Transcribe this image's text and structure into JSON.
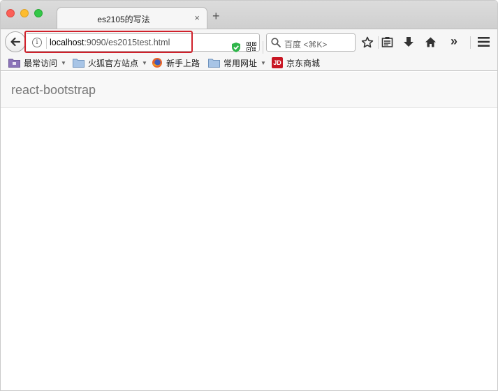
{
  "tab": {
    "title": "es2105的写法",
    "close_glyph": "×",
    "new_tab_glyph": "+"
  },
  "url": {
    "host": "localhost",
    "path": ":9090/es2015test.html",
    "info_glyph": "i"
  },
  "search": {
    "placeholder": "百度 <⌘K>"
  },
  "toolbar_icons": [
    "back-icon",
    "info-icon",
    "shield-icon",
    "qr-code-icon",
    "reload-icon",
    "search-icon",
    "star-icon",
    "reading-list-icon",
    "download-icon",
    "home-icon",
    "overflow-icon",
    "menu-icon"
  ],
  "toolbar": {
    "overflow_glyph": "»"
  },
  "bookmarks": [
    {
      "label": "最常访问",
      "icon": "smart-folder-icon",
      "dropdown": true
    },
    {
      "label": "火狐官方站点",
      "icon": "folder-icon",
      "dropdown": true
    },
    {
      "label": "新手上路",
      "icon": "firefox-icon",
      "dropdown": false
    },
    {
      "label": "常用网址",
      "icon": "folder-icon",
      "dropdown": true
    },
    {
      "label": "京东商城",
      "icon": "jd-icon",
      "dropdown": false
    }
  ],
  "bookmark_caret": "▼",
  "jd_logo_text": "JD",
  "page": {
    "brand": "react-bootstrap"
  },
  "colors": {
    "highlight": "#d0212b",
    "shield": "#2fb54a",
    "brand_text": "#777777"
  }
}
